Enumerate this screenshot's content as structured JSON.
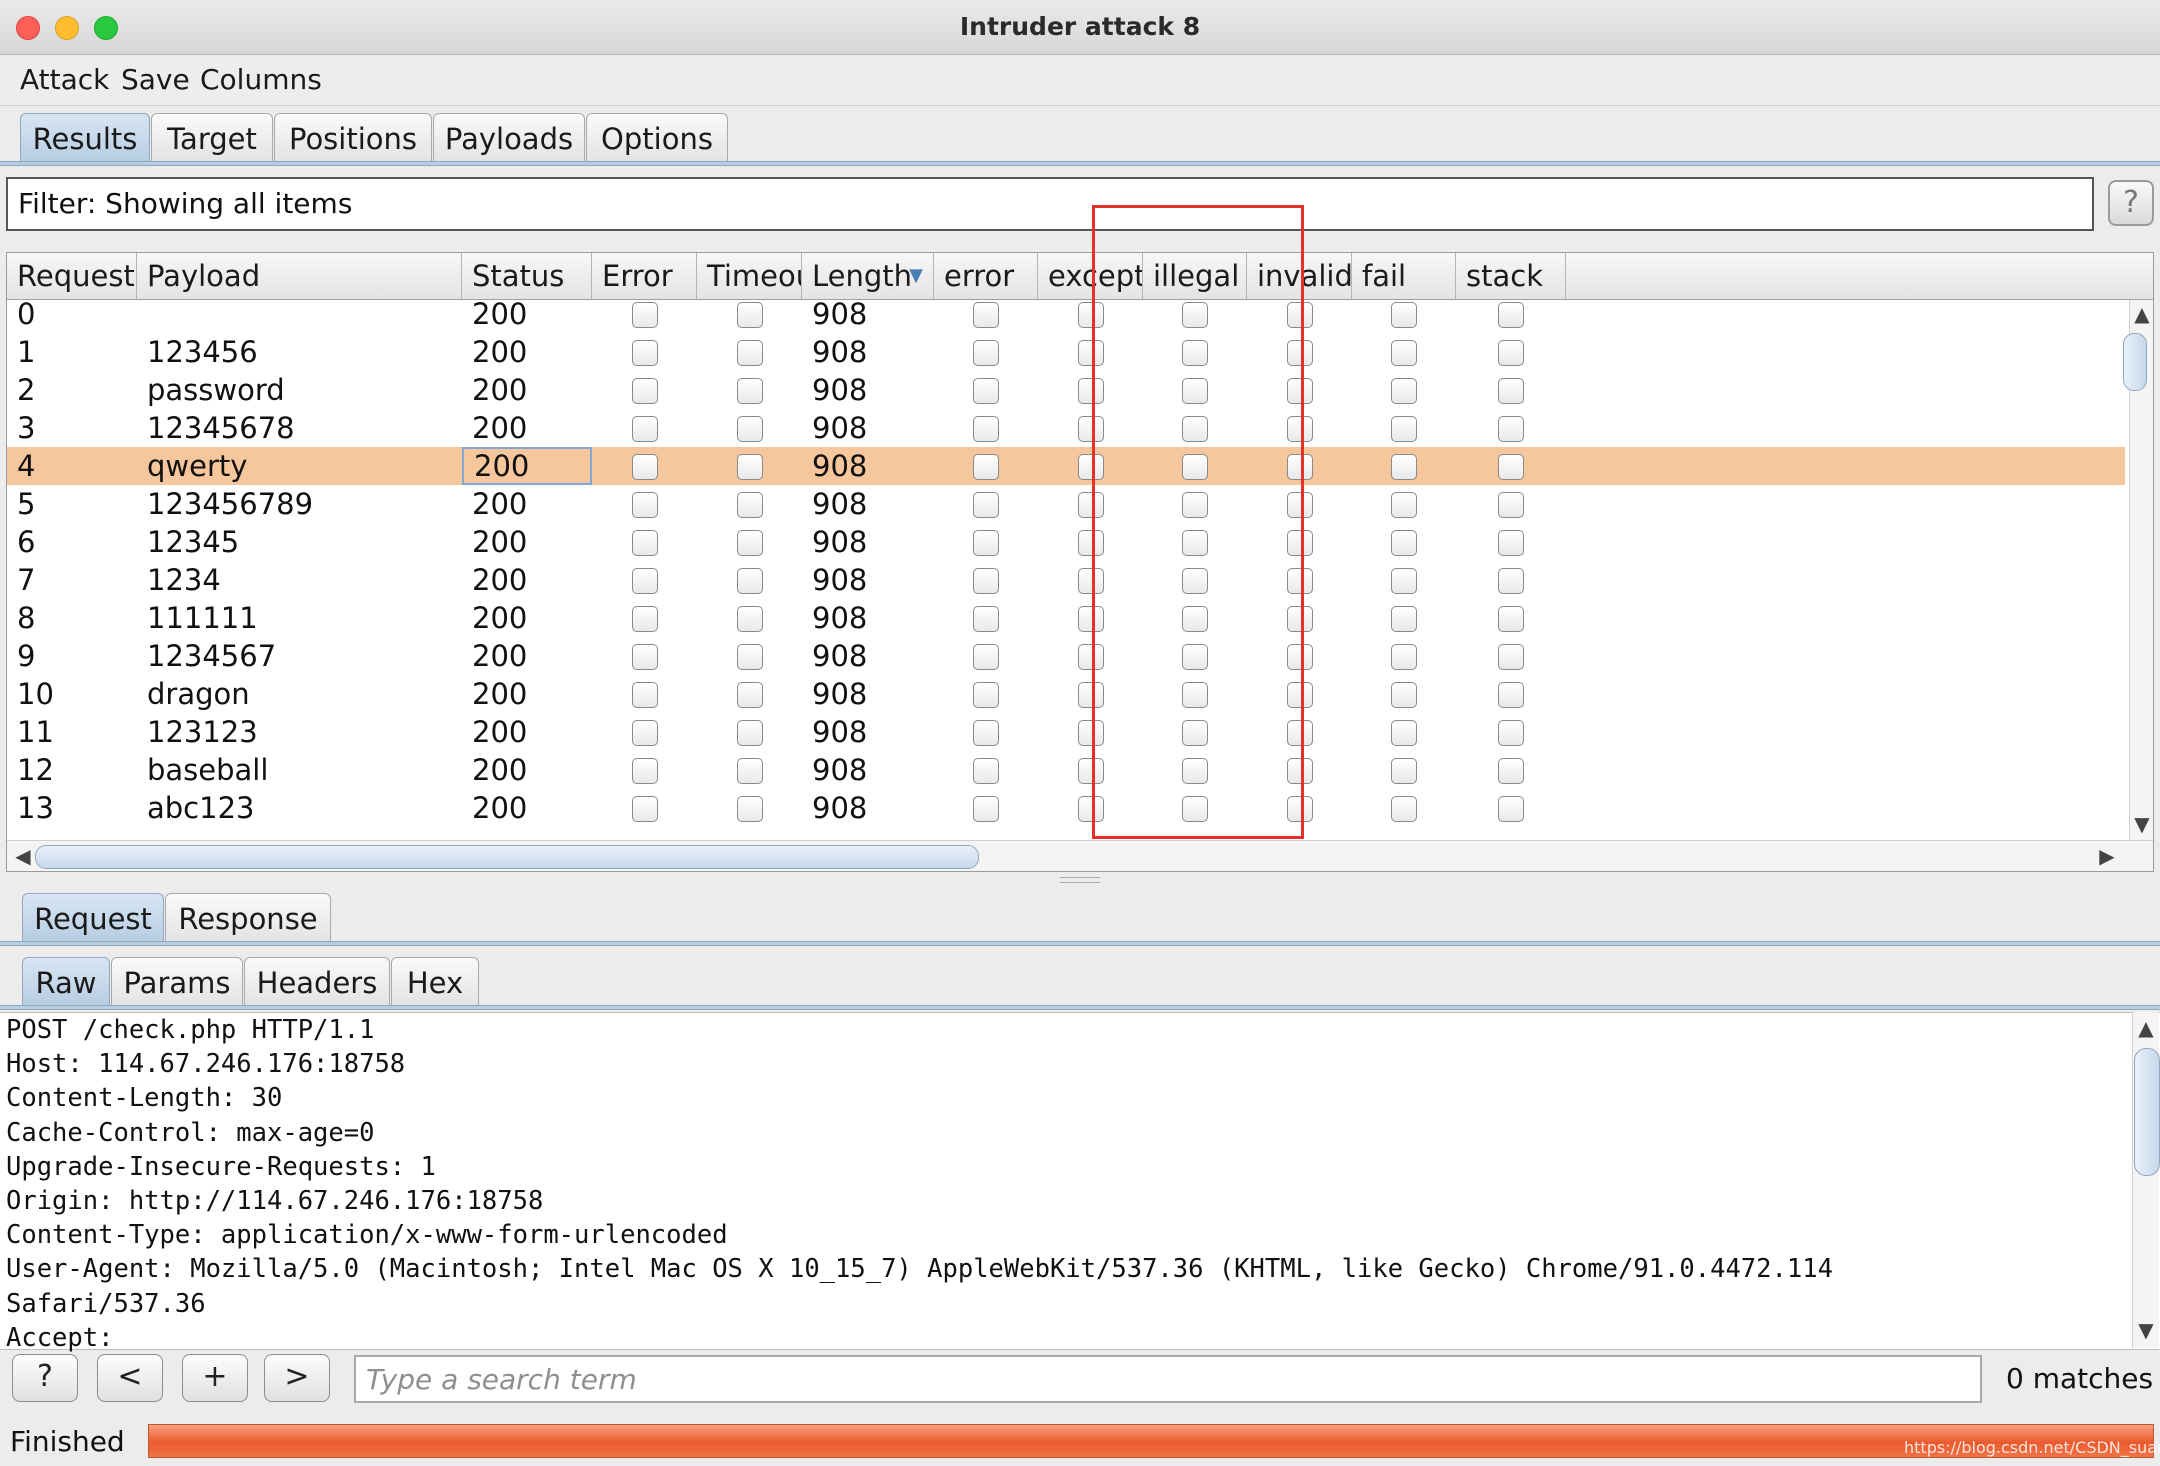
{
  "window": {
    "title": "Intruder attack 8"
  },
  "menu": [
    "Attack",
    "Save",
    "Columns"
  ],
  "main_tabs": [
    "Results",
    "Target",
    "Positions",
    "Payloads",
    "Options"
  ],
  "filter": {
    "text": "Filter: Showing all items",
    "help": "?"
  },
  "table": {
    "columns": [
      "Request",
      "Payload",
      "Status",
      "Error",
      "Timeout",
      "Length",
      "error",
      "excepti...",
      "illegal",
      "invalid",
      "fail",
      "stack"
    ],
    "sort_column": "Length",
    "sort_arrow": "▼",
    "selected_row": 4,
    "rows": [
      {
        "request": "0",
        "payload": "",
        "status": "200",
        "length": "908"
      },
      {
        "request": "1",
        "payload": "123456",
        "status": "200",
        "length": "908"
      },
      {
        "request": "2",
        "payload": "password",
        "status": "200",
        "length": "908"
      },
      {
        "request": "3",
        "payload": "12345678",
        "status": "200",
        "length": "908"
      },
      {
        "request": "4",
        "payload": "qwerty",
        "status": "200",
        "length": "908"
      },
      {
        "request": "5",
        "payload": "123456789",
        "status": "200",
        "length": "908"
      },
      {
        "request": "6",
        "payload": "12345",
        "status": "200",
        "length": "908"
      },
      {
        "request": "7",
        "payload": "1234",
        "status": "200",
        "length": "908"
      },
      {
        "request": "8",
        "payload": "111111",
        "status": "200",
        "length": "908"
      },
      {
        "request": "9",
        "payload": "1234567",
        "status": "200",
        "length": "908"
      },
      {
        "request": "10",
        "payload": "dragon",
        "status": "200",
        "length": "908"
      },
      {
        "request": "11",
        "payload": "123123",
        "status": "200",
        "length": "908"
      },
      {
        "request": "12",
        "payload": "baseball",
        "status": "200",
        "length": "908"
      },
      {
        "request": "13",
        "payload": "abc123",
        "status": "200",
        "length": "908"
      }
    ]
  },
  "lower_tabs": [
    "Request",
    "Response"
  ],
  "view_tabs": [
    "Raw",
    "Params",
    "Headers",
    "Hex"
  ],
  "request_raw": [
    "POST /check.php HTTP/1.1",
    "Host: 114.67.246.176:18758",
    "Content-Length: 30",
    "Cache-Control: max-age=0",
    "Upgrade-Insecure-Requests: 1",
    "Origin: http://114.67.246.176:18758",
    "Content-Type: application/x-www-form-urlencoded",
    "User-Agent: Mozilla/5.0 (Macintosh; Intel Mac OS X 10_15_7) AppleWebKit/537.36 (KHTML, like Gecko) Chrome/91.0.4472.114",
    "Safari/537.36",
    "Accept:"
  ],
  "search": {
    "help": "?",
    "prev": "<",
    "add": "+",
    "next": ">",
    "placeholder": "Type a search term",
    "matches": "0 matches"
  },
  "status": {
    "text": "Finished",
    "progress": 1.0
  },
  "watermark": "https://blog.csdn.net/CSDN_suany",
  "colors": {
    "selected_row": "#f6c69c",
    "highlight_box": "#e2332a",
    "progress": "#ea5a2e",
    "active_tab": "#b7cde2"
  }
}
